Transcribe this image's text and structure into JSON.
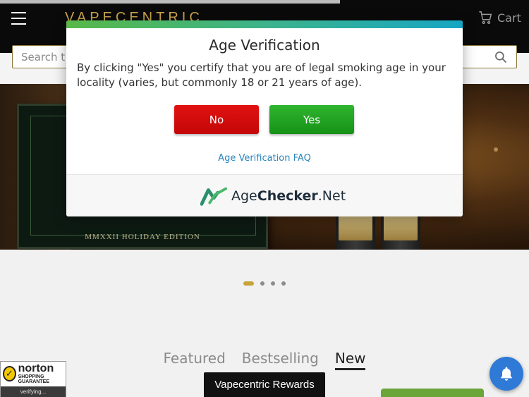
{
  "header": {
    "logo_text": "VAPECENTRIC",
    "cart_label": "Cart",
    "menu_icon": "hamburger-icon",
    "cart_icon": "cart-icon"
  },
  "search": {
    "placeholder": "Search t",
    "icon": "search-icon"
  },
  "hero": {
    "edition_text": "MMXXII HOLIDAY EDITION",
    "slide_count": 4,
    "active_slide": 1
  },
  "product_tabs": [
    {
      "label": "Featured",
      "active": false
    },
    {
      "label": "Bestselling",
      "active": false
    },
    {
      "label": "New",
      "active": true
    }
  ],
  "norton": {
    "brand": "norton",
    "subtitle": "SHOPPING GUARANTEE",
    "status": "verifying..."
  },
  "rewards_button": "Vapecentric Rewards",
  "notification_icon": "bell-icon",
  "modal": {
    "title": "Age Verification",
    "body": "By clicking \"Yes\" you certify that you are of legal smoking age in your locality (varies, but commonly 18 or 21 years of age).",
    "no_label": "No",
    "yes_label": "Yes",
    "faq_label": "Age Verification FAQ",
    "brand_prefix": "Age",
    "brand_bold": "Checker",
    "brand_suffix": ".Net"
  },
  "colors": {
    "accent_gold": "#c7a43b",
    "no_red": "#d50c0c",
    "yes_green": "#22a322",
    "link_blue": "#2a85bd",
    "bell_blue": "#2e7ad6"
  }
}
